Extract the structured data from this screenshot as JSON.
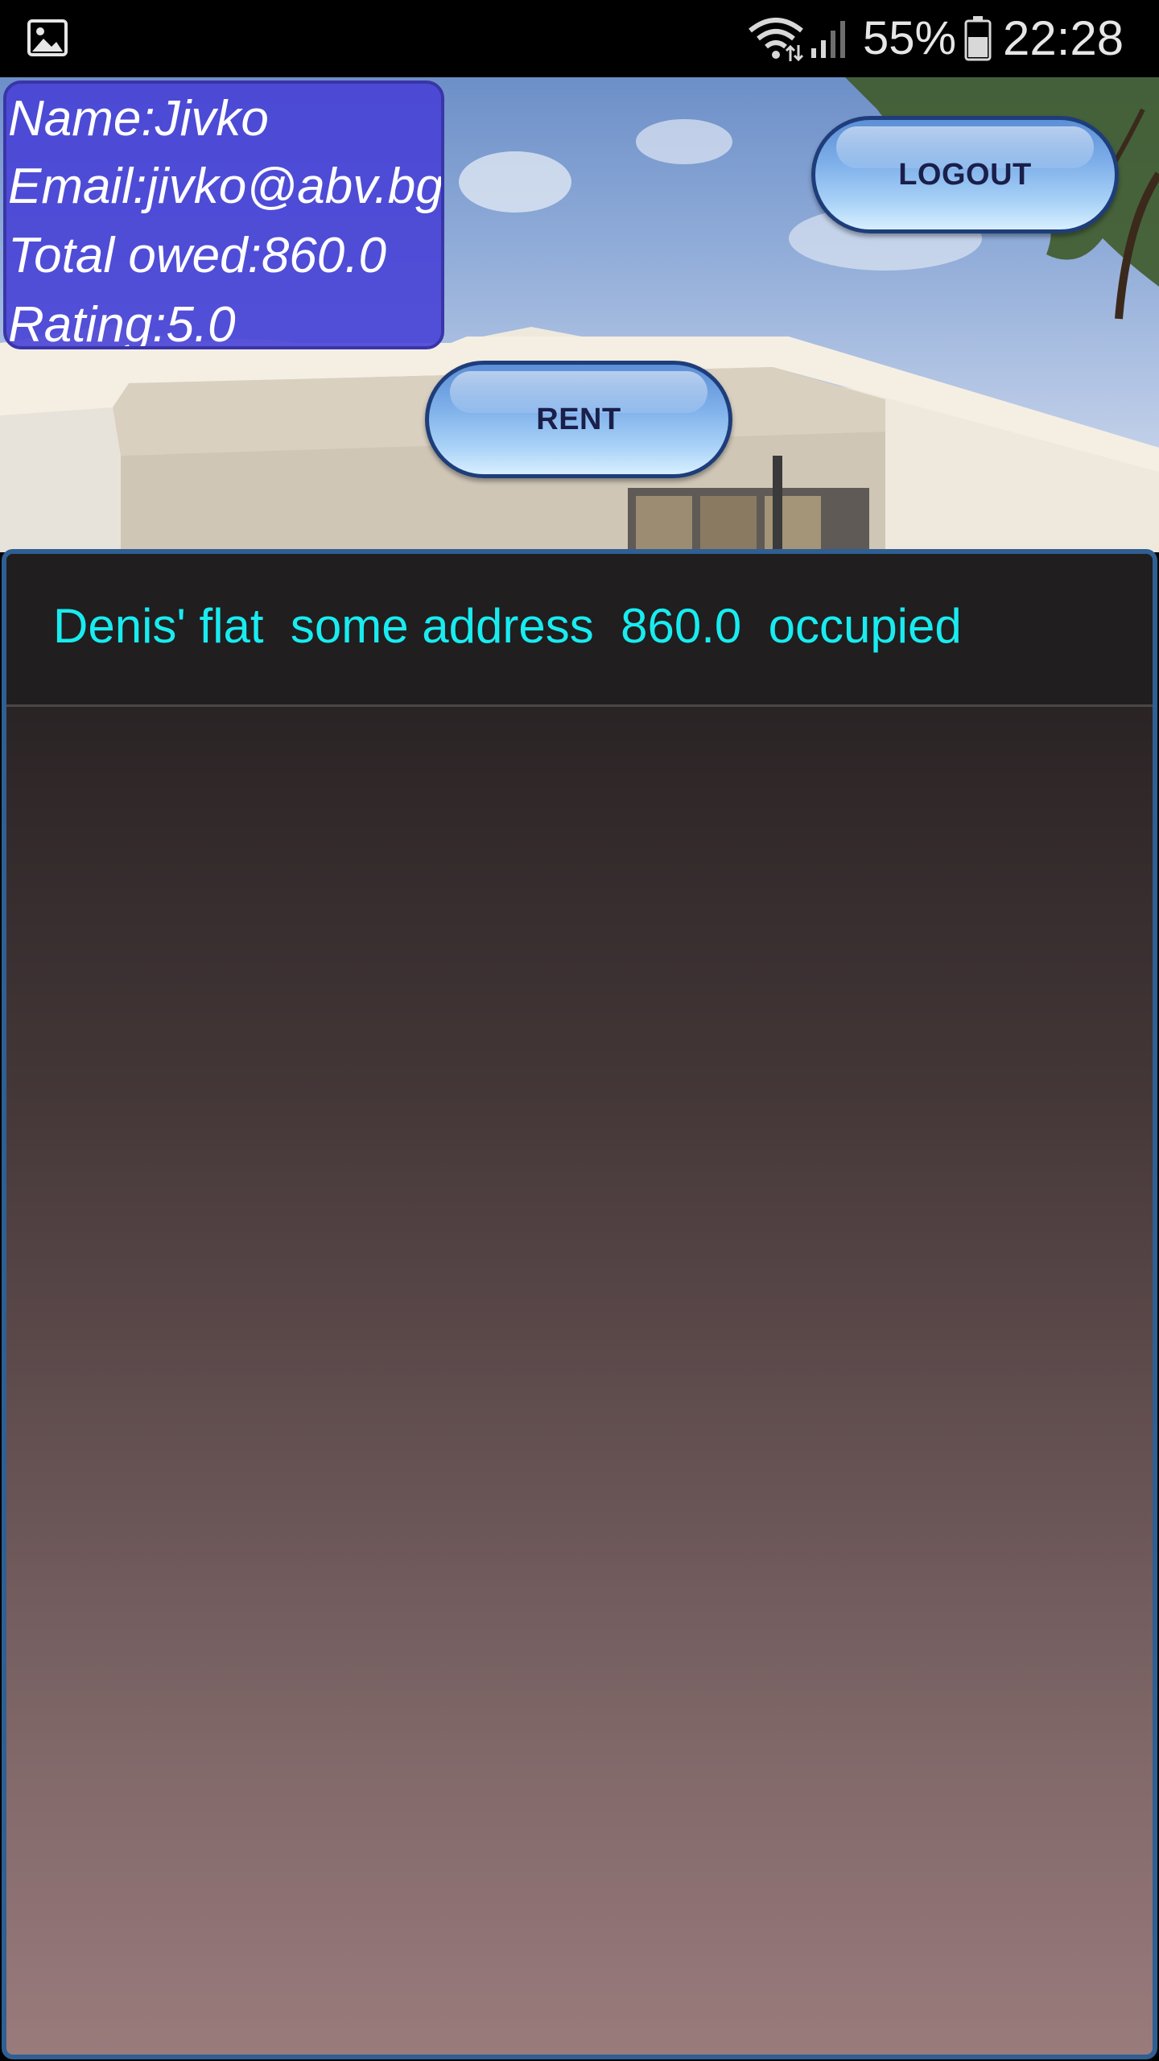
{
  "status_bar": {
    "battery_percent": "55%",
    "time": "22:28",
    "icons": [
      "gallery-icon",
      "wifi-icon",
      "signal-icon",
      "battery-icon"
    ]
  },
  "user_info": {
    "name_line": "Name:Jivko",
    "email_line": "Email:jivko@abv.bg",
    "total_owed_line": "Total owed:860.0",
    "rating_line": "Rating:5.0"
  },
  "buttons": {
    "logout_label": "LOGOUT",
    "rent_label": "RENT"
  },
  "list": {
    "items": [
      {
        "text": "Denis' flat  some address  860.0  occupied"
      }
    ]
  },
  "colors": {
    "card_background": "#4842d6",
    "list_text": "#18ecf0",
    "button_border": "#1e3d7a",
    "panel_border": "#2f5f93"
  }
}
